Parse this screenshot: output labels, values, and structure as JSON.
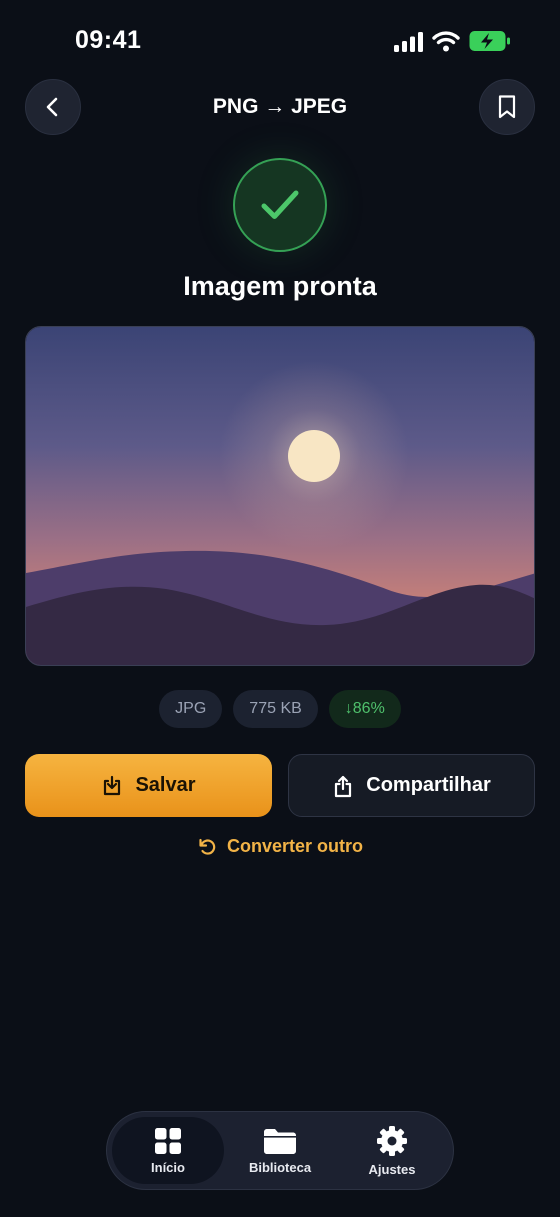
{
  "status_bar": {
    "time": "09:41"
  },
  "header": {
    "title": "PNG → JPEG",
    "back_icon": "chevron-left-icon",
    "bookmark_icon": "bookmark-icon"
  },
  "result": {
    "title": "Imagem pronta",
    "icon": "checkmark-icon",
    "accent": "#35a155"
  },
  "chips": {
    "format": "JPG",
    "size": "775 KB",
    "reduction": "↓86%"
  },
  "actions": {
    "save_label": "Salvar",
    "share_label": "Compartilhar",
    "convert_label": "Converter outro",
    "accent": "#f2b347"
  },
  "tabs": [
    {
      "label": "Início",
      "icon": "grid-icon",
      "active": true
    },
    {
      "label": "Biblioteca",
      "icon": "folder-icon",
      "active": false
    },
    {
      "label": "Ajustes",
      "icon": "gear-icon",
      "active": false
    }
  ]
}
